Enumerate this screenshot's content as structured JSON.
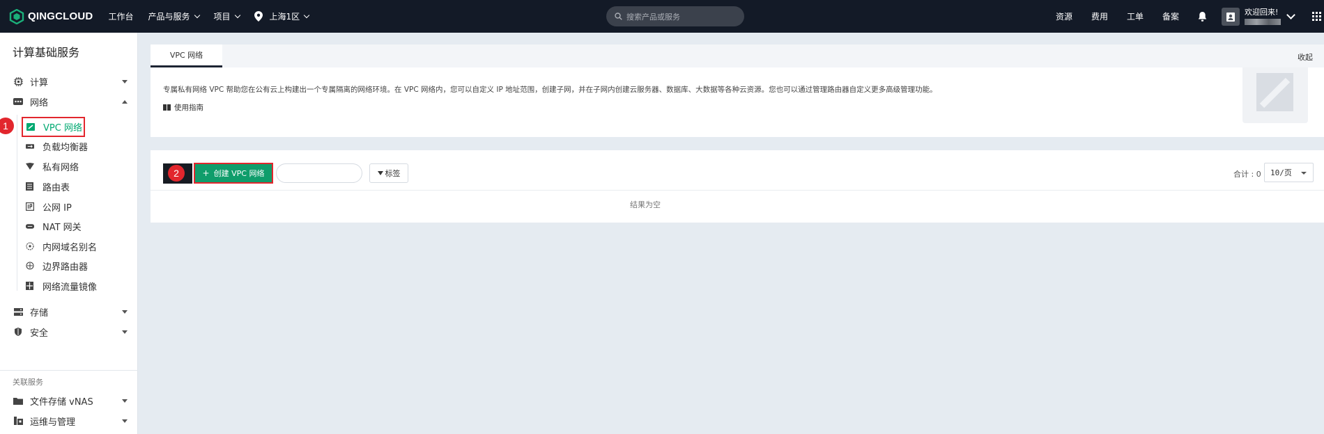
{
  "brand": {
    "name": "QINGCLOUD",
    "accent": "#00a971"
  },
  "topnav": {
    "items": [
      {
        "label": "工作台",
        "dropdown": false
      },
      {
        "label": "产品与服务",
        "dropdown": true
      },
      {
        "label": "项目",
        "dropdown": true
      }
    ],
    "region": "上海1区"
  },
  "search": {
    "placeholder": "搜索产品或服务"
  },
  "topright": {
    "links": [
      "资源",
      "费用",
      "工单",
      "备案"
    ],
    "welcome": "欢迎回来!"
  },
  "sidebar": {
    "title": "计算基础服务",
    "groups": [
      {
        "label": "计算",
        "icon": "chip-icon",
        "expanded": false
      },
      {
        "label": "网络",
        "icon": "network-icon",
        "expanded": true
      },
      {
        "label": "存储",
        "icon": "storage-icon",
        "expanded": false
      },
      {
        "label": "安全",
        "icon": "shield-icon",
        "expanded": false
      }
    ],
    "network_items": [
      {
        "label": "VPC 网络",
        "icon": "vpc-icon",
        "active": true
      },
      {
        "label": "负载均衡器",
        "icon": "load-balancer-icon"
      },
      {
        "label": "私有网络",
        "icon": "private-network-icon"
      },
      {
        "label": "路由表",
        "icon": "route-table-icon"
      },
      {
        "label": "公网 IP",
        "icon": "public-ip-icon"
      },
      {
        "label": "NAT 网关",
        "icon": "nat-gateway-icon"
      },
      {
        "label": "内网域名别名",
        "icon": "dns-alias-icon"
      },
      {
        "label": "边界路由器",
        "icon": "border-router-icon"
      },
      {
        "label": "网络流量镜像",
        "icon": "traffic-mirror-icon"
      }
    ],
    "related_title": "关联服务",
    "related": [
      {
        "label": "文件存储 vNAS",
        "icon": "folder-icon"
      },
      {
        "label": "运维与管理",
        "icon": "ops-icon"
      }
    ]
  },
  "annotations": {
    "step1": "1",
    "step2": "2",
    "color": "#e2262d"
  },
  "main": {
    "tab": "VPC 网络",
    "collapse": "收起",
    "intro": "专属私有网络 VPC 帮助您在公有云上构建出一个专属隔离的网络环境。在 VPC 网络内，您可以自定义 IP 地址范围，创建子网，并在子网内创建云服务器、数据库、大数据等各种云资源。您也可以通过管理路由器自定义更多高级管理功能。",
    "guide": "使用指南",
    "create_button": "创建 VPC 网络",
    "tag_button": "标签",
    "total": "合计 : 0",
    "page_size": "10/页",
    "empty": "结果为空"
  }
}
